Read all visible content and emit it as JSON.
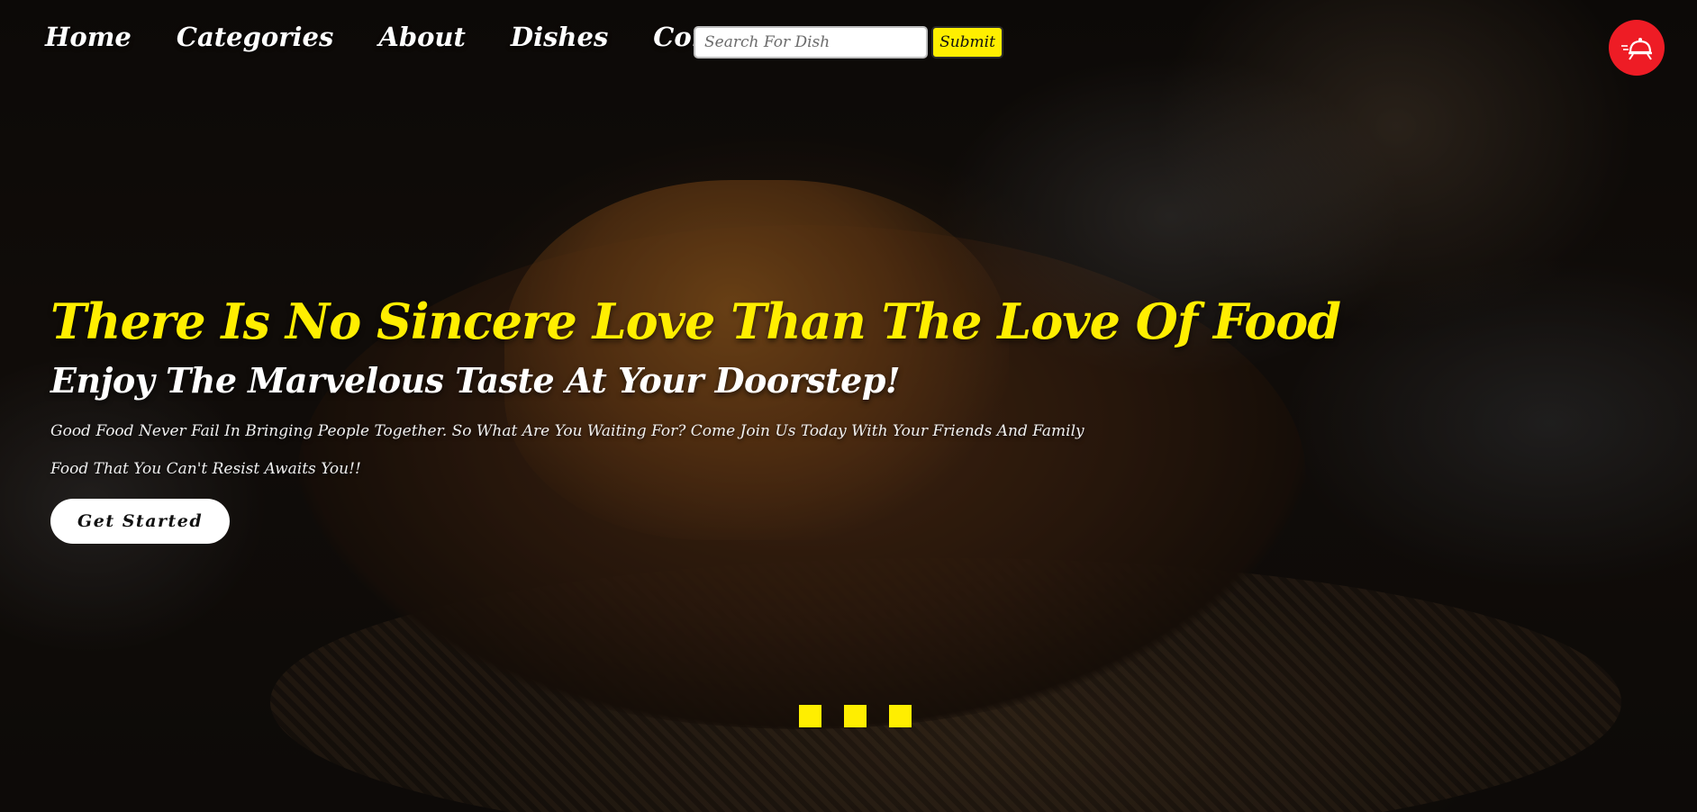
{
  "nav": {
    "links": [
      {
        "label": "Home"
      },
      {
        "label": "Categories"
      },
      {
        "label": "About"
      },
      {
        "label": "Dishes"
      },
      {
        "label": "Contact"
      }
    ],
    "search": {
      "placeholder": "Search For Dish",
      "value": "",
      "submit_label": "Submit"
    },
    "logo": {
      "icon": "cloche-delivery-icon",
      "color": "#ee1c25"
    }
  },
  "hero": {
    "headline": "There Is No Sincere Love Than The Love Of Food",
    "subheadline": "Enjoy The Marvelous Taste At Your Doorstep!",
    "body_lines": [
      "Good Food Never Fail In Bringing People Together. So What Are You Waiting For? Come Join Us Today With Your Friends And Family",
      "Food That You Can't Resist Awaits You!!"
    ],
    "cta_label": "Get Started"
  },
  "slider": {
    "dot_count": 3
  },
  "colors": {
    "accent": "#ffee00",
    "brand_red": "#ee1c25",
    "text": "#ffffff"
  }
}
